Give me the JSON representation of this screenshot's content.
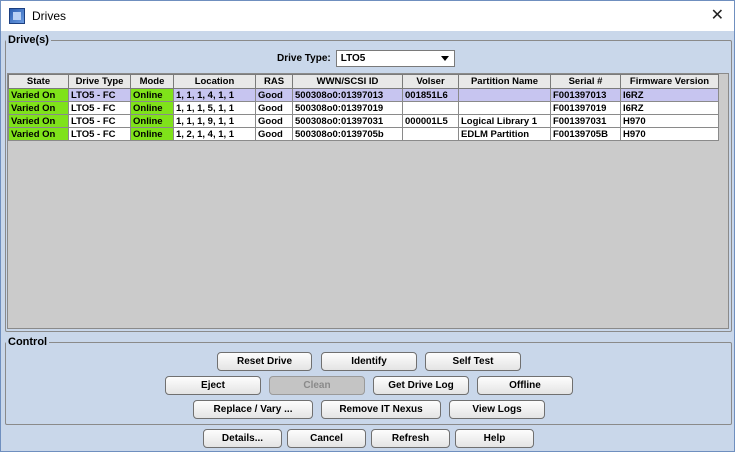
{
  "window": {
    "title": "Drives"
  },
  "drives_section": {
    "legend": "Drive(s)",
    "drive_type_label": "Drive Type:",
    "drive_type_value": "LTO5",
    "columns": [
      "State",
      "Drive Type",
      "Mode",
      "Location",
      "RAS",
      "WWN/SCSI ID",
      "Volser",
      "Partition Name",
      "Serial #",
      "Firmware Version"
    ],
    "rows": [
      [
        "Varied On",
        "LTO5 - FC",
        "Online",
        "1, 1, 1, 4, 1, 1",
        "Good",
        "500308o0:01397013",
        "001851L6",
        "",
        "F001397013",
        "I6RZ"
      ],
      [
        "Varied On",
        "LTO5 - FC",
        "Online",
        "1, 1, 1, 5, 1, 1",
        "Good",
        "500308o0:01397019",
        "",
        "",
        "F001397019",
        "I6RZ"
      ],
      [
        "Varied On",
        "LTO5 - FC",
        "Online",
        "1, 1, 1, 9, 1, 1",
        "Good",
        "500308o0:01397031",
        "000001L5",
        "Logical Library 1",
        "F001397031",
        "H970"
      ],
      [
        "Varied On",
        "LTO5 - FC",
        "Online",
        "1, 2, 1, 4, 1, 1",
        "Good",
        "500308o0:0139705b",
        "",
        "EDLM Partition",
        "F00139705B",
        "H970"
      ]
    ],
    "state_color": "#7fe21a",
    "selected_color": "#c7c5f0"
  },
  "control_section": {
    "legend": "Control",
    "reset_drive": "Reset Drive",
    "identify": "Identify",
    "self_test": "Self Test",
    "eject": "Eject",
    "clean": "Clean",
    "get_drive_log": "Get Drive Log",
    "offline": "Offline",
    "replace_vary": "Replace / Vary ...",
    "remove_it_nexus": "Remove IT Nexus",
    "view_logs": "View Logs"
  },
  "footer": {
    "details": "Details...",
    "cancel": "Cancel",
    "refresh": "Refresh",
    "help": "Help"
  }
}
